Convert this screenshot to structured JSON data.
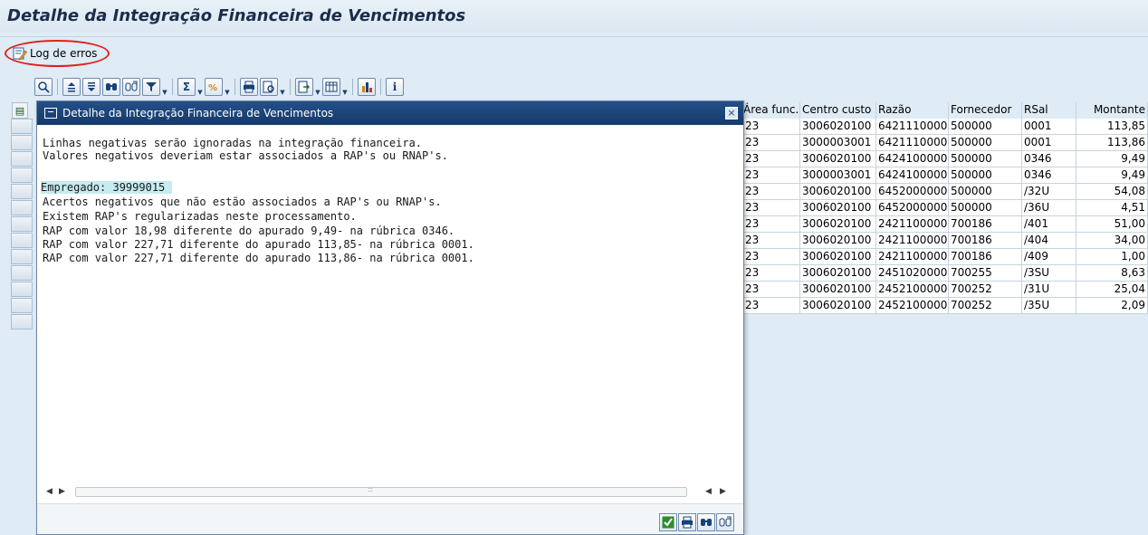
{
  "page": {
    "title": "Detalhe da Integração Financeira de Vencimentos"
  },
  "app_toolbar": {
    "log_button_label": "Log de erros",
    "log_button_icon": "edit-log-icon",
    "highlight_color": "#e0211a"
  },
  "grid_toolbar": {
    "buttons": [
      "details-icon",
      "sort-ascending-icon",
      "sort-descending-icon",
      "find-icon",
      "find-next-icon",
      "filter-icon",
      "sum-icon",
      "subtotal-icon",
      "print-icon",
      "print-preview-icon",
      "export-icon",
      "layout-icon",
      "graphic-icon",
      "info-icon"
    ]
  },
  "grid": {
    "columns": [
      "Área func.",
      "Centro custo",
      "Razão",
      "Fornecedor",
      "RSal",
      "Montante"
    ],
    "rows": [
      [
        "23",
        "3006020100",
        "6421110000",
        "500000",
        "0001",
        "113,85"
      ],
      [
        "23",
        "3000003001",
        "6421110000",
        "500000",
        "0001",
        "113,86"
      ],
      [
        "23",
        "3006020100",
        "6424100000",
        "500000",
        "0346",
        "9,49"
      ],
      [
        "23",
        "3000003001",
        "6424100000",
        "500000",
        "0346",
        "9,49"
      ],
      [
        "23",
        "3006020100",
        "6452000000",
        "500000",
        "/32U",
        "54,08"
      ],
      [
        "23",
        "3006020100",
        "6452000000",
        "500000",
        "/36U",
        "4,51"
      ],
      [
        "23",
        "3006020100",
        "2421100000",
        "700186",
        "/401",
        "51,00"
      ],
      [
        "23",
        "3006020100",
        "2421100000",
        "700186",
        "/404",
        "34,00"
      ],
      [
        "23",
        "3006020100",
        "2421100000",
        "700186",
        "/409",
        "1,00"
      ],
      [
        "23",
        "3006020100",
        "2451020000",
        "700255",
        "/3SU",
        "8,63"
      ],
      [
        "23",
        "3006020100",
        "2452100000",
        "700252",
        "/31U",
        "25,04"
      ],
      [
        "23",
        "3006020100",
        "2452100000",
        "700252",
        "/35U",
        "2,09"
      ]
    ]
  },
  "dialog": {
    "title": "Detalhe da Integração Financeira de Vencimentos",
    "close_label": "×",
    "lines": [
      "Linhas negativas serão ignoradas na integração financeira.",
      "Valores negativos deveriam estar associados a RAP's ou RNAP's.",
      "",
      "Empregado: 39999015",
      "Acertos negativos que não estão associados a RAP's ou RNAP's.",
      "Existem RAP's regularizadas neste processamento.",
      "RAP com valor 18,98 diferente do apurado 9,49- na rúbrica 0346.",
      "RAP com valor 227,71 diferente do apurado 113,85- na rúbrica 0001.",
      "RAP com valor 227,71 diferente do apurado 113,86- na rúbrica 0001."
    ],
    "highlight_color": "#c6ebf0",
    "footer_buttons": [
      "confirm-icon",
      "print-icon",
      "find-icon",
      "find-next-icon"
    ]
  }
}
